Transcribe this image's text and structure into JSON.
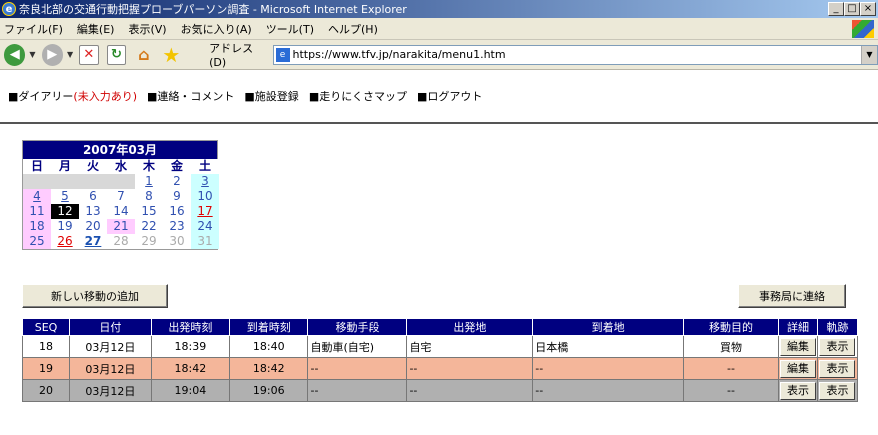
{
  "window": {
    "title": "奈良北部の交通行動把握プローブパーソン調査 - Microsoft Internet Explorer",
    "buttons": [
      "_",
      "□",
      "×"
    ]
  },
  "menu": [
    "ファイル(F)",
    "編集(E)",
    "表示(V)",
    "お気に入り(A)",
    "ツール(T)",
    "ヘルプ(H)"
  ],
  "toolbar": {
    "address_label": "アドレス(D)",
    "url": "https://www.tfv.jp/narakita/menu1.htm"
  },
  "nav": {
    "diary": "■ダイアリー",
    "diary_note": "(未入力あり)",
    "contact": "■連絡・コメント",
    "facility": "■施設登録",
    "map": "■走りにくさマップ",
    "logout": "■ログアウト"
  },
  "calendar": {
    "title": "2007年03月",
    "dow": [
      "日",
      "月",
      "火",
      "水",
      "木",
      "金",
      "土"
    ],
    "days": [
      "",
      "",
      "",
      "",
      "1",
      "2",
      "3",
      "4",
      "5",
      "6",
      "7",
      "8",
      "9",
      "10",
      "11",
      "12",
      "13",
      "14",
      "15",
      "16",
      "17",
      "18",
      "19",
      "20",
      "21",
      "22",
      "23",
      "24",
      "25",
      "26",
      "27",
      "28",
      "29",
      "30",
      "31"
    ]
  },
  "buttons": {
    "add_trip": "新しい移動の追加",
    "contact_office": "事務局に連絡"
  },
  "table": {
    "headers": [
      "SEQ",
      "日付",
      "出発時刻",
      "到着時刻",
      "移動手段",
      "出発地",
      "到着地",
      "移動目的",
      "詳細",
      "軌跡"
    ],
    "rows": [
      {
        "seq": "18",
        "date": "03月12日",
        "dep": "18:39",
        "arr": "18:40",
        "mode": "自動車(自宅)",
        "from": "自宅",
        "to": "日本橋",
        "purpose": "買物",
        "detail": "編集",
        "track": "表示"
      },
      {
        "seq": "19",
        "date": "03月12日",
        "dep": "18:42",
        "arr": "18:42",
        "mode": "--",
        "from": "--",
        "to": "--",
        "purpose": "--",
        "detail": "編集",
        "track": "表示"
      },
      {
        "seq": "20",
        "date": "03月12日",
        "dep": "19:04",
        "arr": "19:06",
        "mode": "--",
        "from": "--",
        "to": "--",
        "purpose": "--",
        "detail": "表示",
        "track": "表示"
      }
    ]
  }
}
